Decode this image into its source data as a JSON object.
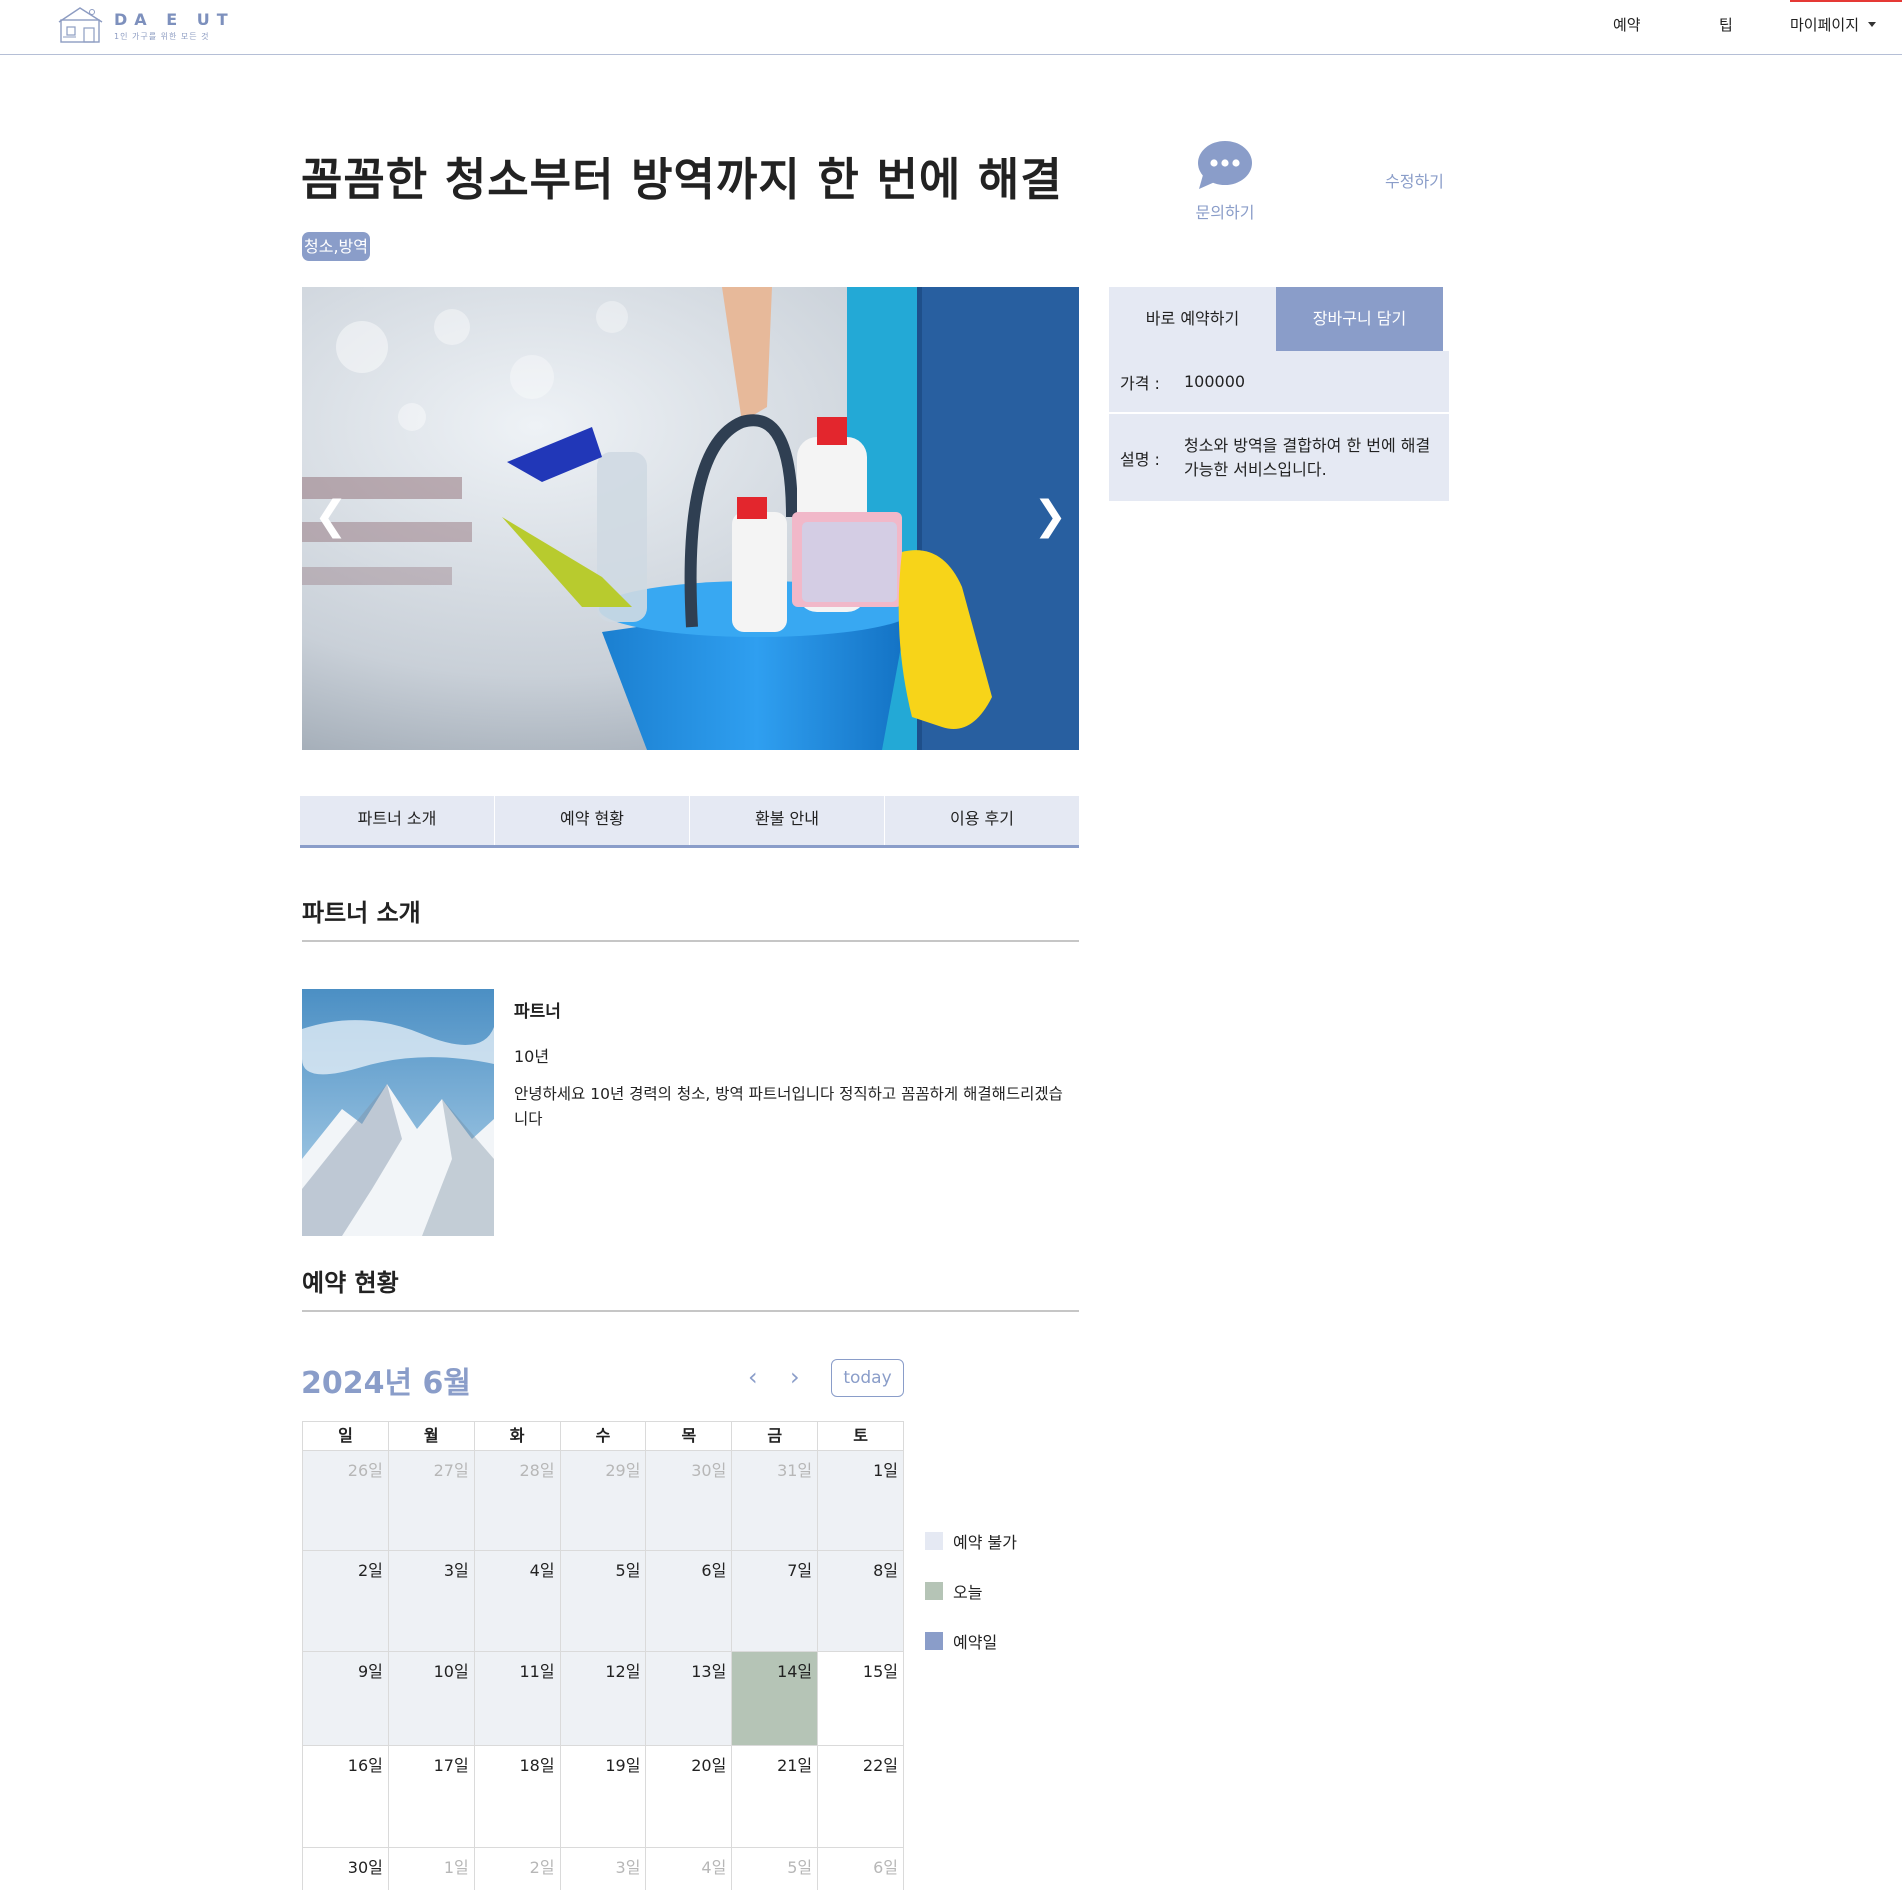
{
  "header": {
    "logo_name": "DA E UT",
    "logo_sub": "1인 가구를 위한 모든 것",
    "nav": {
      "reserve": "예약",
      "tip": "팁",
      "mypage": "마이페이지"
    }
  },
  "product": {
    "title": "꼼꼼한 청소부터 방역까지 한 번에 해결",
    "tag": "청소,방역",
    "inquiry_label": "문의하기",
    "edit_label": "수정하기"
  },
  "slider": {
    "prev": "❮",
    "next": "❯"
  },
  "panel": {
    "book_label": "바로 예약하기",
    "cart_label": "장바구니 담기",
    "price_label": "가격 :",
    "price_value": "100000",
    "desc_label": "설명 :",
    "desc_value": "청소와 방역을 결합하여 한 번에 해결 가능한 서비스입니다."
  },
  "tabs": [
    "파트너 소개",
    "예약 현황",
    "환불 안내",
    "이용 후기"
  ],
  "partner": {
    "section_title": "파트너 소개",
    "name": "파트너",
    "years": "10년",
    "bio": "안녕하세요 10년 경력의 청소, 방역 파트너입니다 정직하고 꼼꼼하게 해결해드리겠습니다"
  },
  "reservation": {
    "section_title": "예약 현황",
    "month_title": "2024년 6월",
    "prev": "‹",
    "next": "›",
    "today_label": "today",
    "weekdays": [
      "일",
      "월",
      "화",
      "수",
      "목",
      "금",
      "토"
    ],
    "weeks": [
      [
        {
          "d": "26일",
          "s": "other-unavail"
        },
        {
          "d": "27일",
          "s": "other-unavail"
        },
        {
          "d": "28일",
          "s": "other-unavail"
        },
        {
          "d": "29일",
          "s": "other-unavail"
        },
        {
          "d": "30일",
          "s": "other-unavail"
        },
        {
          "d": "31일",
          "s": "other-unavail"
        },
        {
          "d": "1일",
          "s": "unavail"
        }
      ],
      [
        {
          "d": "2일",
          "s": "unavail"
        },
        {
          "d": "3일",
          "s": "unavail"
        },
        {
          "d": "4일",
          "s": "unavail"
        },
        {
          "d": "5일",
          "s": "unavail"
        },
        {
          "d": "6일",
          "s": "unavail"
        },
        {
          "d": "7일",
          "s": "unavail"
        },
        {
          "d": "8일",
          "s": "unavail"
        }
      ],
      [
        {
          "d": "9일",
          "s": "unavail"
        },
        {
          "d": "10일",
          "s": "unavail"
        },
        {
          "d": "11일",
          "s": "unavail"
        },
        {
          "d": "12일",
          "s": "unavail"
        },
        {
          "d": "13일",
          "s": "unavail"
        },
        {
          "d": "14일",
          "s": "today"
        },
        {
          "d": "15일",
          "s": ""
        }
      ],
      [
        {
          "d": "16일",
          "s": ""
        },
        {
          "d": "17일",
          "s": ""
        },
        {
          "d": "18일",
          "s": ""
        },
        {
          "d": "19일",
          "s": ""
        },
        {
          "d": "20일",
          "s": ""
        },
        {
          "d": "21일",
          "s": ""
        },
        {
          "d": "22일",
          "s": ""
        }
      ],
      [
        {
          "d": "30일",
          "s": ""
        },
        {
          "d": "1일",
          "s": "other"
        },
        {
          "d": "2일",
          "s": "other"
        },
        {
          "d": "3일",
          "s": "other"
        },
        {
          "d": "4일",
          "s": "other"
        },
        {
          "d": "5일",
          "s": "other"
        },
        {
          "d": "6일",
          "s": "other"
        }
      ]
    ],
    "legend": [
      {
        "label": "예약 불가",
        "color": "#e5e9f3"
      },
      {
        "label": "오늘",
        "color": "#b5c4b6"
      },
      {
        "label": "예약일",
        "color": "#8a9dc9"
      }
    ]
  },
  "colors": {
    "accent": "#8a9dc9",
    "panel_bg": "#e5e9f3",
    "today": "#b5c4b6",
    "unavailable": "#eef1f5"
  }
}
